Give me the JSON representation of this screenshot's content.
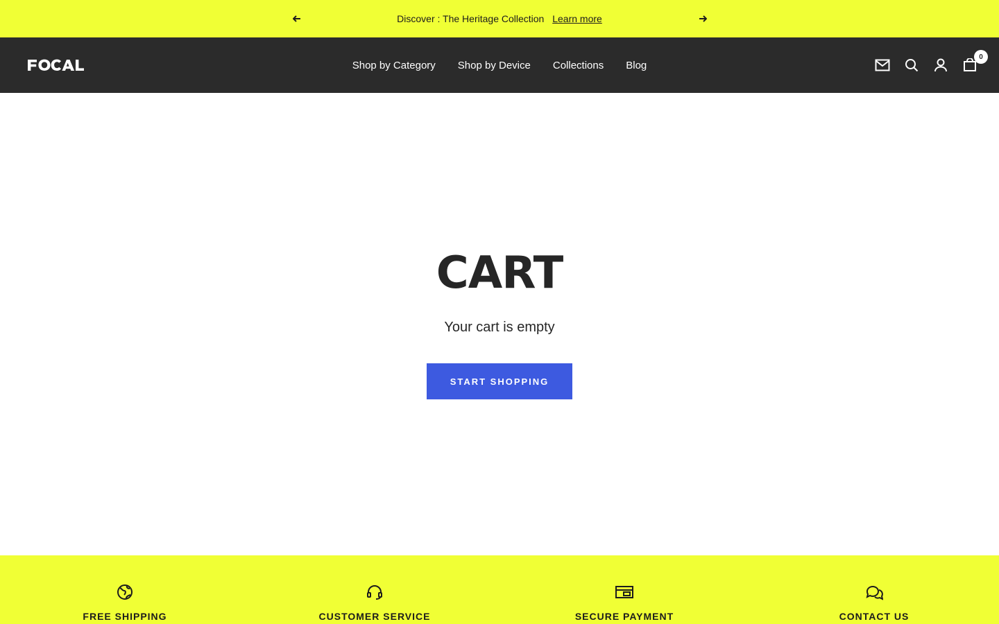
{
  "announcement": {
    "message": "Discover : The Heritage Collection",
    "link_label": "Learn more",
    "prev_icon": "arrow-left-icon",
    "next_icon": "arrow-right-icon",
    "background": "#f0ff35"
  },
  "header": {
    "logo_text": "FOCAL",
    "background": "#2b2b2b",
    "nav": [
      {
        "label": "Shop by Category"
      },
      {
        "label": "Shop by Device"
      },
      {
        "label": "Collections"
      },
      {
        "label": "Blog"
      }
    ],
    "icons": [
      "mail-icon",
      "search-icon",
      "account-icon",
      "cart-icon"
    ],
    "cart_count": "0"
  },
  "main": {
    "title": "CART",
    "empty_message": "Your cart is empty",
    "button_label": "START SHOPPING",
    "button_color": "#3d5ae0"
  },
  "features": [
    {
      "label": "FREE SHIPPING",
      "icon": "globe-icon"
    },
    {
      "label": "CUSTOMER SERVICE",
      "icon": "headset-icon"
    },
    {
      "label": "SECURE PAYMENT",
      "icon": "credit-card-icon"
    },
    {
      "label": "CONTACT US",
      "icon": "chat-bubbles-icon"
    }
  ]
}
